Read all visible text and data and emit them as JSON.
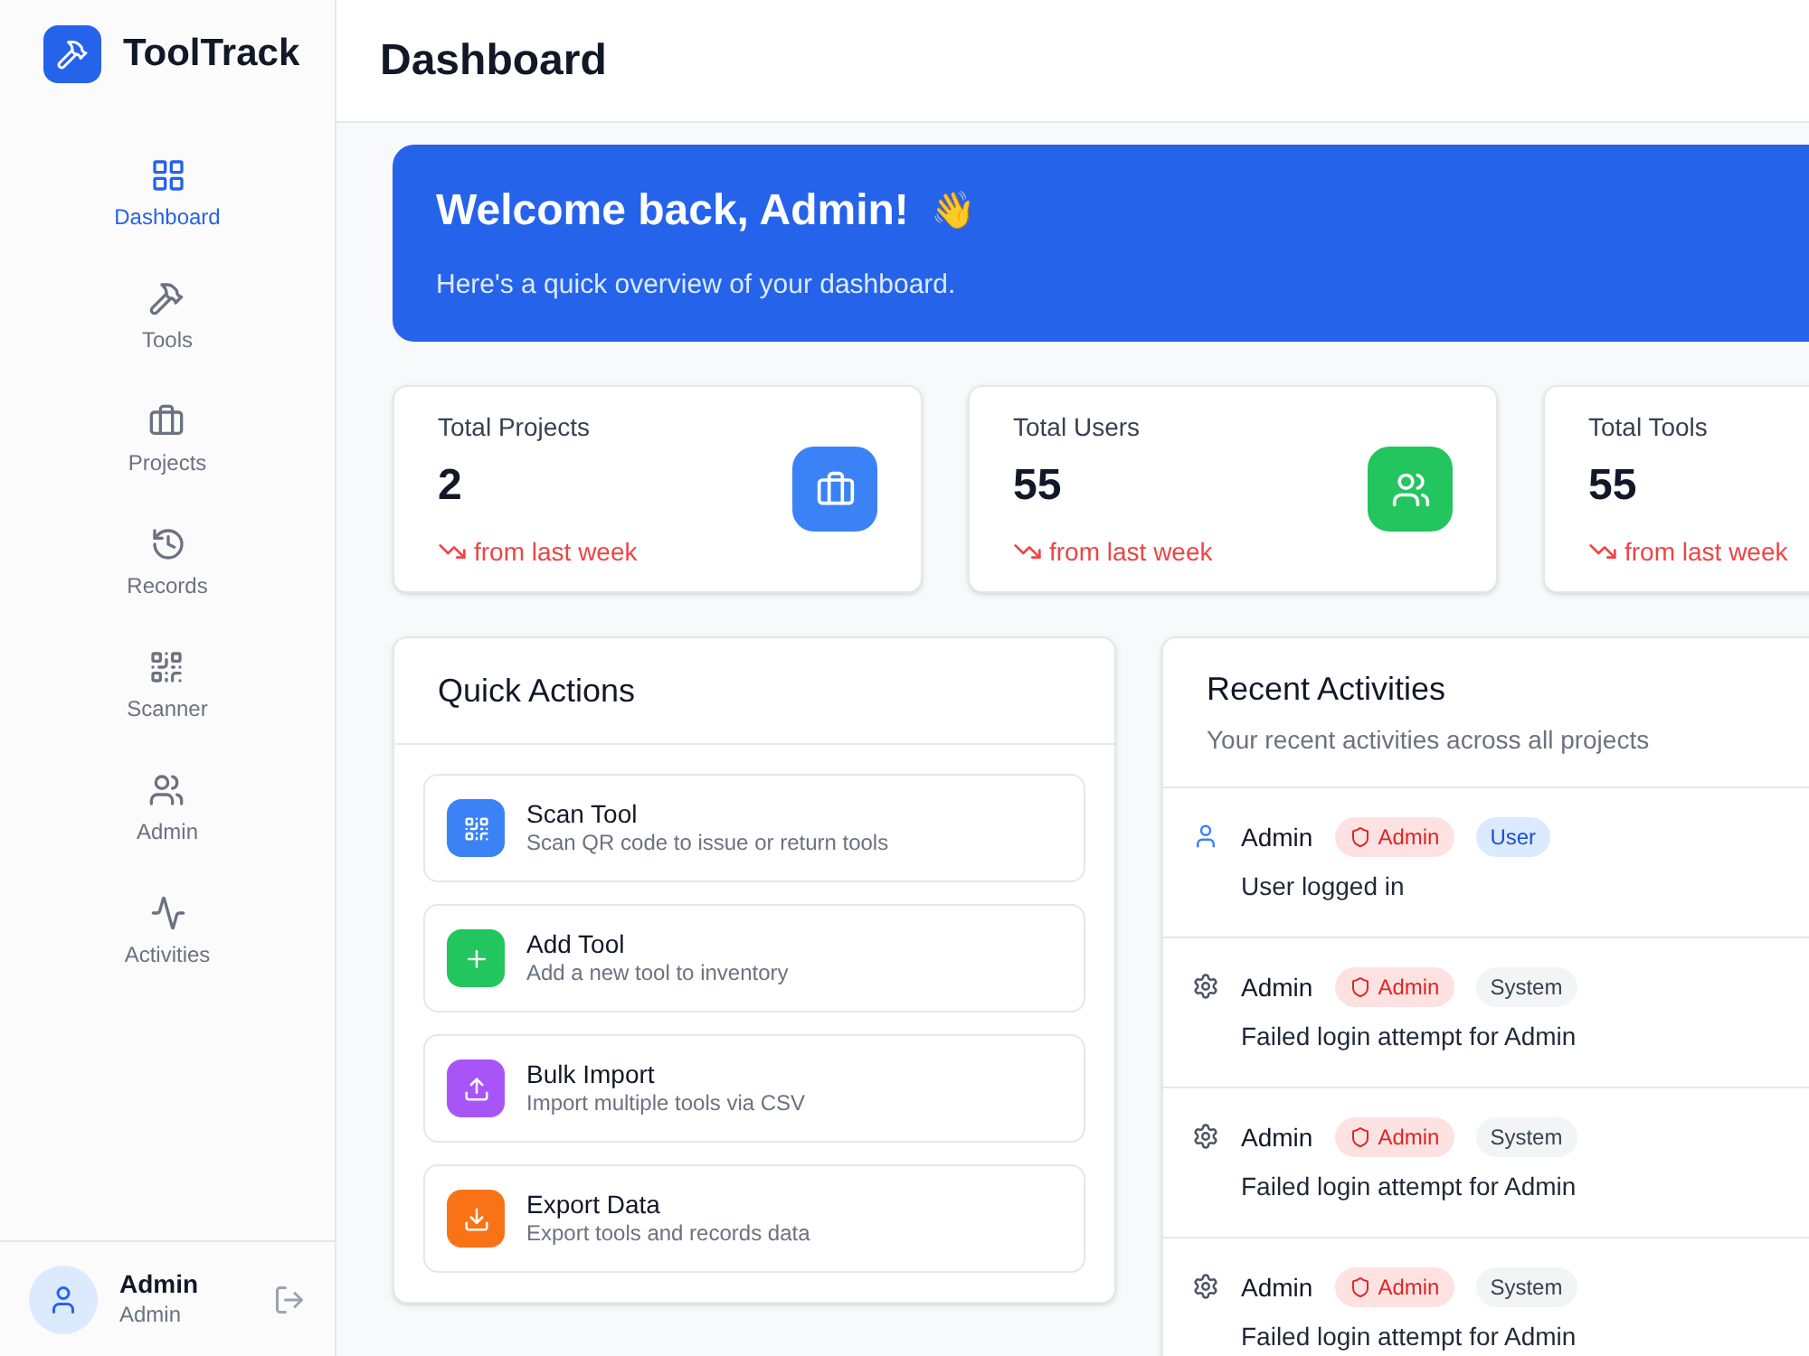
{
  "app": {
    "name": "ToolTrack"
  },
  "sidebar": {
    "items": [
      {
        "label": "Dashboard",
        "selected": true
      },
      {
        "label": "Tools",
        "selected": false
      },
      {
        "label": "Projects",
        "selected": false
      },
      {
        "label": "Records",
        "selected": false
      },
      {
        "label": "Scanner",
        "selected": false
      },
      {
        "label": "Admin",
        "selected": false
      },
      {
        "label": "Activities",
        "selected": false
      }
    ],
    "user": {
      "name": "Admin",
      "role": "Admin"
    }
  },
  "header": {
    "title": "Dashboard"
  },
  "welcome": {
    "title": "Welcome back, Admin!",
    "emoji": "👋",
    "subtitle": "Here's a quick overview of your dashboard."
  },
  "stats": [
    {
      "label": "Total Projects",
      "value": "2",
      "trend": "from last week"
    },
    {
      "label": "Total Users",
      "value": "55",
      "trend": "from last week"
    },
    {
      "label": "Total Tools",
      "value": "55",
      "trend": "from last week"
    }
  ],
  "quick_actions": {
    "title": "Quick Actions",
    "items": [
      {
        "title": "Scan Tool",
        "description": "Scan QR code to issue or return tools",
        "color": "#3b82f6"
      },
      {
        "title": "Add Tool",
        "description": "Add a new tool to inventory",
        "color": "#22c55e"
      },
      {
        "title": "Bulk Import",
        "description": "Import multiple tools via CSV",
        "color": "#a855f7"
      },
      {
        "title": "Export Data",
        "description": "Export tools and records data",
        "color": "#f97316"
      }
    ]
  },
  "recent_activities": {
    "title": "Recent Activities",
    "subtitle": "Your recent activities across all projects",
    "items": [
      {
        "kind": "user",
        "user": "Admin",
        "role": "Admin",
        "tag": "User",
        "message": "User logged in"
      },
      {
        "kind": "system",
        "user": "Admin",
        "role": "Admin",
        "tag": "System",
        "message": "Failed login attempt for Admin"
      },
      {
        "kind": "system",
        "user": "Admin",
        "role": "Admin",
        "tag": "System",
        "message": "Failed login attempt for Admin"
      },
      {
        "kind": "system",
        "user": "Admin",
        "role": "Admin",
        "tag": "System",
        "message": "Failed login attempt for Admin"
      }
    ]
  }
}
